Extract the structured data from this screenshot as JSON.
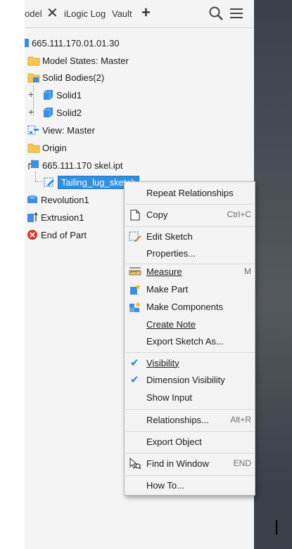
{
  "tabs": {
    "model_label": "odel",
    "ilogic_label": "iLogic Log",
    "vault_label": "Vault"
  },
  "tree": {
    "root_label": "665.111.170.01.01.30",
    "model_states_label": "Model States: Master",
    "solid_bodies_label": "Solid Bodies(2)",
    "solid1_label": "Solid1",
    "solid2_label": "Solid2",
    "view_label": "View: Master",
    "origin_label": "Origin",
    "skel_label": "665.111.170 skel.ipt",
    "sketch_label": "Tailing_lug_sketch",
    "revolution_label": "Revolution1",
    "extrusion_label": "Extrusion1",
    "end_label": "End of Part"
  },
  "menu": {
    "repeat": "Repeat Relationships",
    "copy": "Copy",
    "copy_sc": "Ctrl+C",
    "edit_sketch": "Edit Sketch",
    "properties": "Properties...",
    "measure": "Measure",
    "measure_sc": "M",
    "make_part": "Make Part",
    "make_components": "Make Components",
    "create_note": "Create Note",
    "export_sketch": "Export Sketch As...",
    "visibility": "Visibility",
    "dimension_visibility": "Dimension Visibility",
    "show_input": "Show Input",
    "relationships": "Relationships...",
    "relationships_sc": "Alt+R",
    "export_object": "Export Object",
    "find_in_window": "Find in Window",
    "find_sc": "END",
    "how_to": "How To..."
  },
  "colors": {
    "selection": "#2f8fe0",
    "check": "#2e86d4",
    "folder": "#f5c84c",
    "solid": "#3a8ee6",
    "end_of_part": "#d9372b"
  }
}
